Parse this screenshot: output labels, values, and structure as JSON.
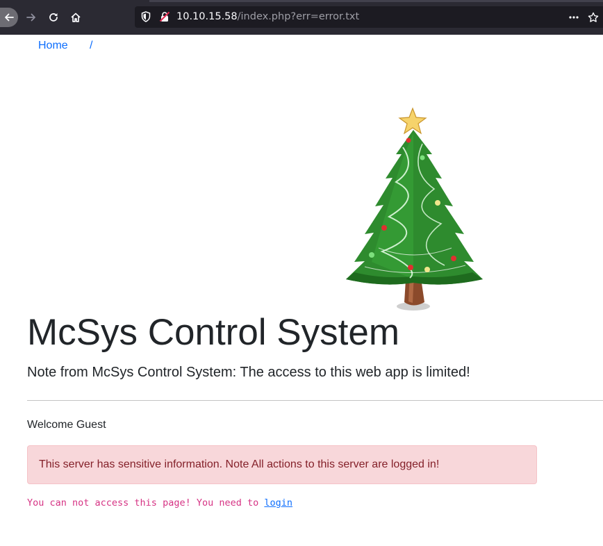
{
  "browser": {
    "url_host": "10.10.15.58",
    "url_path": "/index.php?err=error.txt",
    "icons": [
      "back-icon",
      "forward-icon",
      "reload-icon",
      "home-icon",
      "shield-icon",
      "insecure-lock-icon",
      "more-icon",
      "bookmark-icon"
    ]
  },
  "breadcrumb": {
    "home": "Home",
    "separator": "/"
  },
  "hero_image": "christmas-tree",
  "page": {
    "title": "McSys Control System",
    "note": "Note from McSys Control System: The access to this web app is limited!",
    "welcome": "Welcome Guest",
    "alert": "This server has sensitive information. Note All actions to this server are logged in!",
    "access_message": "You can not access this page! You need to ",
    "login_link": "login"
  },
  "colors": {
    "link": "#0d6efd",
    "alert_bg": "#f8d7da",
    "alert_text": "#842029",
    "code_text": "#d63384",
    "toolbar_bg": "#2b2a33"
  }
}
